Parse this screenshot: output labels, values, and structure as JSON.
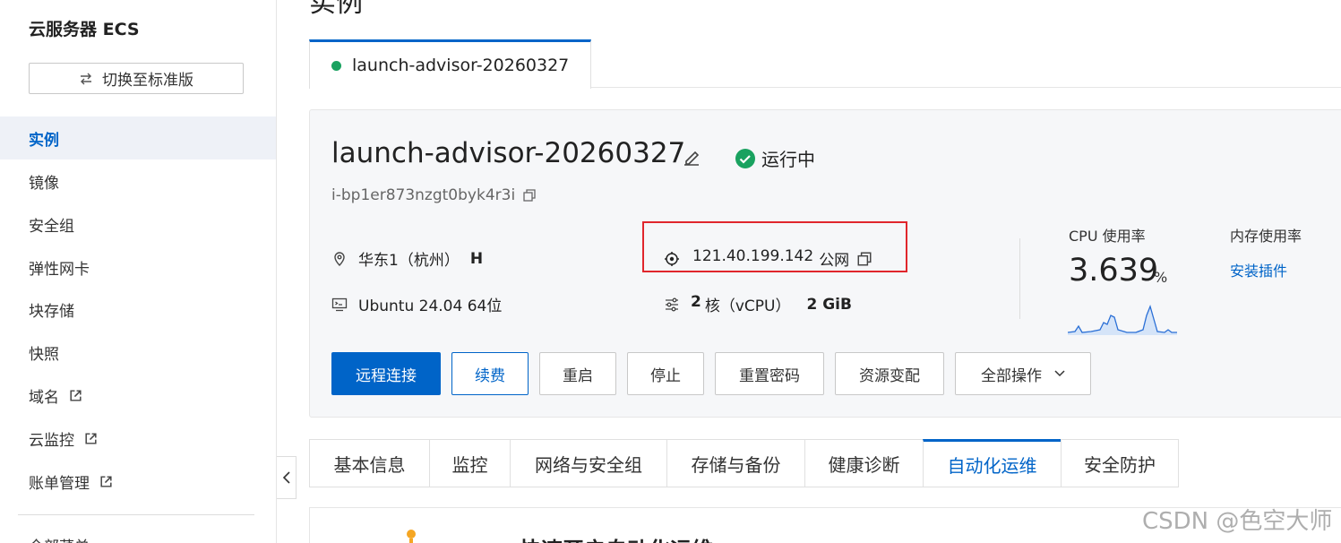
{
  "sidebar": {
    "title": "云服务器 ECS",
    "switch_label": "切换至标准版",
    "items": [
      {
        "label": "实例"
      },
      {
        "label": "镜像"
      },
      {
        "label": "安全组"
      },
      {
        "label": "弹性网卡"
      },
      {
        "label": "块存储"
      },
      {
        "label": "快照"
      },
      {
        "label": "域名"
      },
      {
        "label": "云监控"
      },
      {
        "label": "账单管理"
      }
    ],
    "partial_label": "全部菜单"
  },
  "page": {
    "title": "实例",
    "top_tab": "launch-advisor-20260327"
  },
  "instance": {
    "name": "launch-advisor-20260327",
    "status": "运行中",
    "id": "i-bp1er873nzgt0byk4r3i",
    "region": "华东1（杭州）",
    "zone": "H",
    "ip": "121.40.199.142",
    "ip_type": "公网",
    "os": "Ubuntu 24.04 64位",
    "cpu_cores": "2",
    "cpu_label": "核（vCPU）",
    "memory": "2 GiB"
  },
  "metrics": {
    "cpu_label": "CPU 使用率",
    "cpu_value": "3.639",
    "cpu_unit": "%",
    "mem_label": "内存使用率",
    "mem_link": "安装插件"
  },
  "actions": {
    "remote": "远程连接",
    "renew": "续费",
    "restart": "重启",
    "stop": "停止",
    "reset_pwd": "重置密码",
    "resize": "资源变配",
    "all_ops": "全部操作"
  },
  "tabs": [
    {
      "label": "基本信息"
    },
    {
      "label": "监控"
    },
    {
      "label": "网络与安全组"
    },
    {
      "label": "存储与备份"
    },
    {
      "label": "健康诊断"
    },
    {
      "label": "自动化运维"
    },
    {
      "label": "安全防护"
    }
  ],
  "bottom": {
    "title": "快速开启自动化运维"
  },
  "watermark": "CSDN @色空大师",
  "colors": {
    "accent": "#0064c8",
    "success": "#1aa260",
    "highlight": "#e0262c"
  }
}
